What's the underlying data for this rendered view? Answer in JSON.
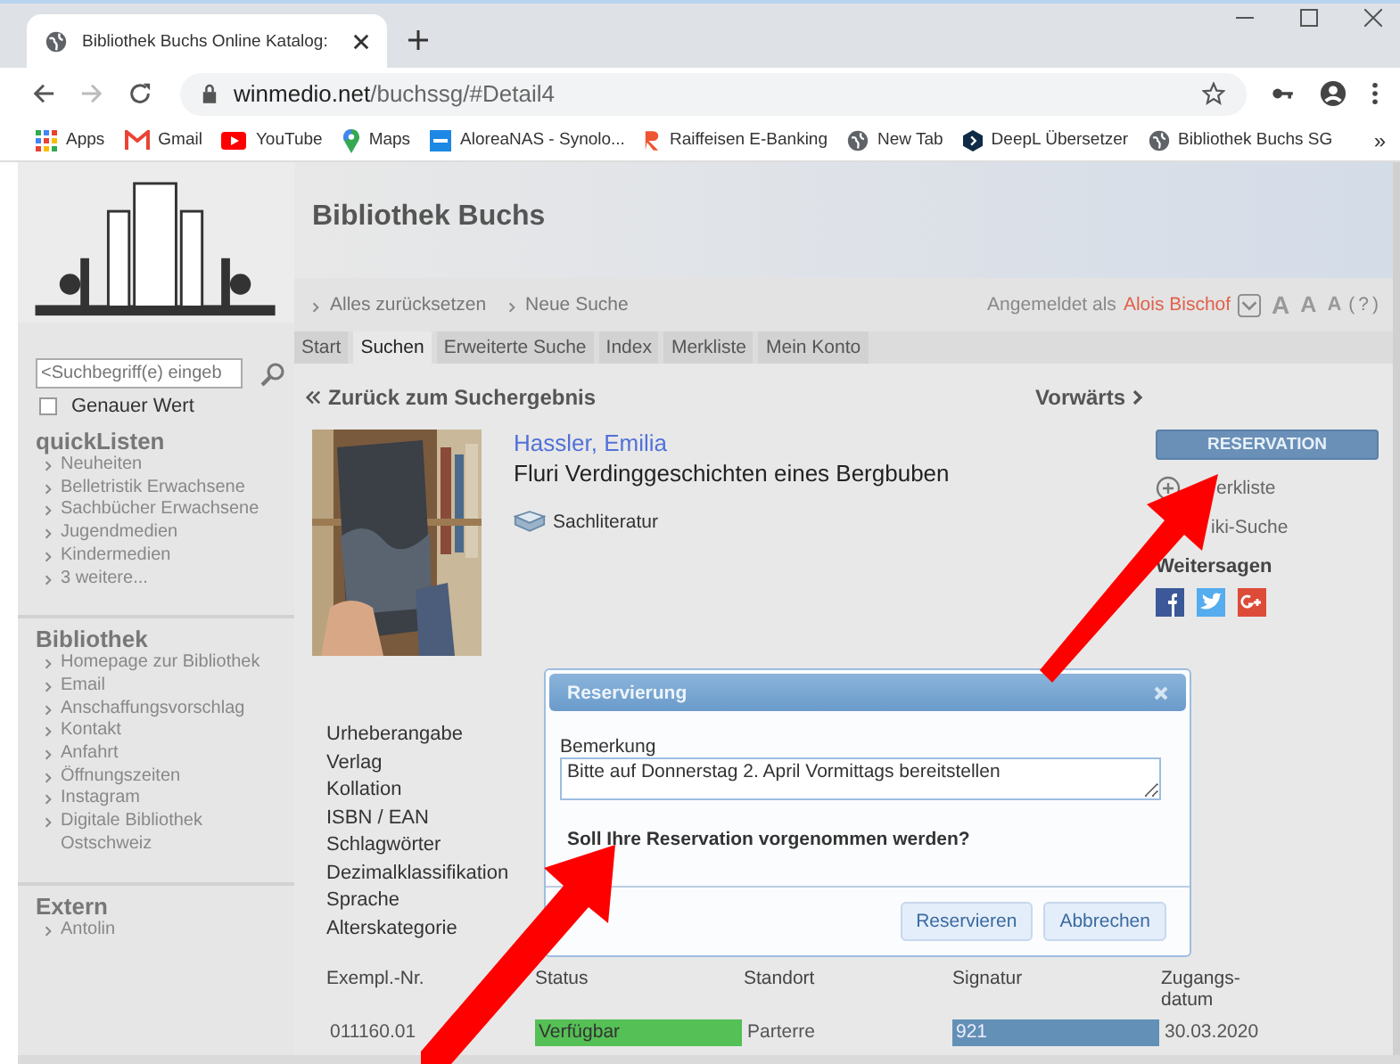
{
  "browser": {
    "tab_title": "Bibliothek Buchs Online Katalog:",
    "url_domain": "winmedio.net",
    "url_path": "/buchssg/#Detail4",
    "bookmarks": [
      {
        "label": "Apps",
        "kind": "apps"
      },
      {
        "label": "Gmail",
        "kind": "mail"
      },
      {
        "label": "YouTube",
        "kind": "video"
      },
      {
        "label": "Maps",
        "kind": "pin"
      },
      {
        "label": "AloreaNAS - Synolo...",
        "kind": "nas"
      },
      {
        "label": "Raiffeisen E-Banking",
        "kind": "bank"
      },
      {
        "label": "New Tab",
        "kind": "globe"
      },
      {
        "label": "DeepL Übersetzer",
        "kind": "hex"
      },
      {
        "label": "Bibliothek Buchs SG",
        "kind": "globe"
      }
    ],
    "more": "»"
  },
  "sidebar": {
    "search": {
      "placeholder": "<Suchbegriff(e) eingeb"
    },
    "exact": {
      "label": "Genauer Wert",
      "checked": false
    },
    "sections": [
      {
        "title": "quickListen",
        "items": [
          "Neuheiten",
          "Belletristik Erwachsene",
          "Sachbücher Erwachsene",
          "Jugendmedien",
          "Kindermedien",
          "3 weitere..."
        ]
      },
      {
        "title": "Bibliothek",
        "items": [
          "Homepage zur Bibliothek",
          "Email",
          "Anschaffungsvorschlag",
          "Kontakt",
          "Anfahrt",
          "Öffnungszeiten",
          "Instagram",
          "Digitale Bibliothek Ostschweiz"
        ]
      },
      {
        "title": "Extern",
        "items": [
          "Antolin"
        ]
      }
    ]
  },
  "header": {
    "title": "Bibliothek Buchs"
  },
  "breadcrumbs": [
    "Alles zurücksetzen",
    "Neue Suche"
  ],
  "user": {
    "prefix": "Angemeldet als",
    "name": "Alois Bischof",
    "font_sizes": [
      "A",
      "A",
      "A"
    ],
    "help": "(?)"
  },
  "tabs": [
    {
      "label": "Start",
      "selected": false
    },
    {
      "label": "Suchen",
      "selected": true
    },
    {
      "label": "Erweiterte Suche",
      "selected": false
    },
    {
      "label": "Index",
      "selected": false
    },
    {
      "label": "Merkliste",
      "selected": false
    },
    {
      "label": "Mein Konto",
      "selected": false
    }
  ],
  "nav": {
    "back": "Zurück zum Suchergebnis",
    "forward": "Vorwärts"
  },
  "record": {
    "author": "Hassler, Emilia",
    "title": "Fluri Verdinggeschichten eines Bergbuben",
    "media_type": "Sachliteratur",
    "fields": [
      "Urheberangabe",
      "Verlag",
      "Kollation",
      "ISBN / EAN",
      "Schlagwörter",
      "Dezimalklassifikation",
      "Sprache",
      "Alterskategorie"
    ]
  },
  "actions": {
    "reserve": "RESERVATION",
    "links": [
      "erkliste",
      "iki-Suche"
    ],
    "share_title": "Weitersagen",
    "share": [
      {
        "kind": "facebook"
      },
      {
        "kind": "twitter"
      },
      {
        "kind": "google"
      }
    ]
  },
  "copies": {
    "columns": [
      "Exempl.-Nr.",
      "Status",
      "Standort",
      "Signatur",
      "Zugangs-datum"
    ],
    "rows": [
      [
        {
          "kind": "text",
          "text": "011160.01"
        },
        {
          "kind": "status",
          "text": "Verfügbar"
        },
        {
          "kind": "text",
          "text": "Parterre"
        },
        {
          "kind": "signature",
          "text": "921"
        },
        {
          "kind": "text",
          "text": "30.03.2020"
        }
      ]
    ]
  },
  "dialog": {
    "title": "Reservierung",
    "field_label": "Bemerkung",
    "value": "Bitte auf Donnerstag 2. April Vormittags bereitstellen",
    "question": "Soll Ihre Reservation vorgenommen werden?",
    "buttons": [
      "Reservieren",
      "Abbrechen"
    ]
  }
}
